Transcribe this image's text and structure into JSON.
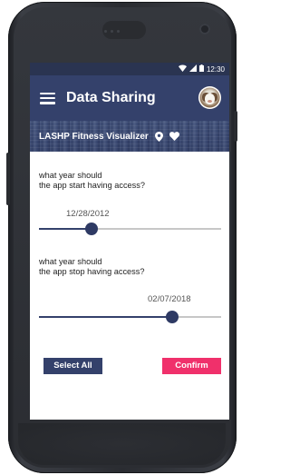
{
  "status_bar": {
    "time": "12:30",
    "icons": [
      "wifi-icon",
      "signal-icon",
      "battery-icon"
    ]
  },
  "app_bar": {
    "title": "Data Sharing",
    "menu_icon": "menu-icon",
    "avatar": "user-avatar"
  },
  "banner": {
    "title": "LASHP Fitness Visualizer",
    "icons": [
      "location-pin-icon",
      "heart-icon"
    ]
  },
  "start_access": {
    "question_line1": "what year should",
    "question_line2": "the app start having access?",
    "date": "12/28/2012",
    "slider_position": 0.29
  },
  "stop_access": {
    "question_line1": "what year should",
    "question_line2": "the app stop having access?",
    "date": "02/07/2018",
    "slider_position": 0.73
  },
  "buttons": {
    "select_all": "Select All",
    "confirm": "Confirm"
  },
  "colors": {
    "primary": "#34416b",
    "status_bar": "#2a3451",
    "accent": "#f0306b"
  }
}
